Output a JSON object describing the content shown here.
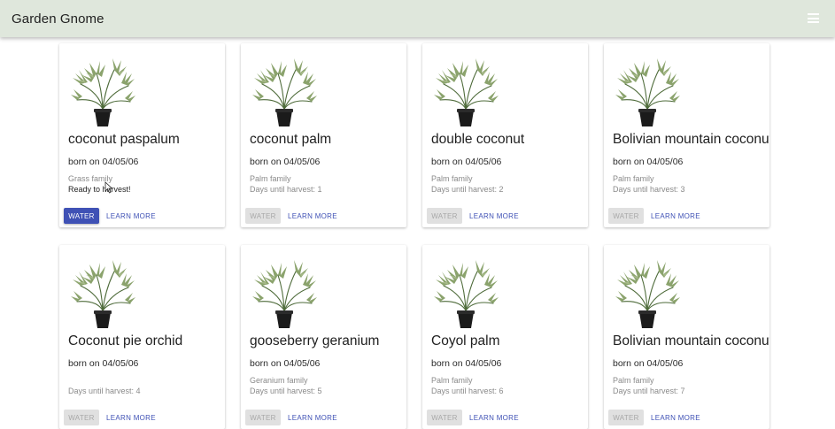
{
  "appbar": {
    "title": "Garden Gnome",
    "menu_icon": "hamburger-menu-icon"
  },
  "card_actions": {
    "water_label": "WATER",
    "learn_label": "LEARN MORE"
  },
  "plant_icon": "potted-palm-icon",
  "colors": {
    "appbar_bg": "#dfe7dc",
    "primary": "#3f51b5",
    "disabled_bg": "#e0e0e0",
    "disabled_text": "#a8a8a8"
  },
  "cards": [
    {
      "name": "coconut paspalum",
      "born": "born on 04/05/06",
      "family": "Grass family",
      "harvest": "Ready to harvest!",
      "water_enabled": true
    },
    {
      "name": "coconut palm",
      "born": "born on 04/05/06",
      "family": "Palm family",
      "harvest": "Days until harvest: 1",
      "water_enabled": false
    },
    {
      "name": "double coconut",
      "born": "born on 04/05/06",
      "family": "Palm family",
      "harvest": "Days until harvest: 2",
      "water_enabled": false
    },
    {
      "name": "Bolivian mountain coconut",
      "born": "born on 04/05/06",
      "family": "Palm family",
      "harvest": "Days until harvest: 3",
      "water_enabled": false
    },
    {
      "name": "Coconut pie orchid",
      "born": "born on 04/05/06",
      "family": "",
      "harvest": "Days until harvest: 4",
      "water_enabled": false
    },
    {
      "name": "gooseberry geranium",
      "born": "born on 04/05/06",
      "family": "Geranium family",
      "harvest": "Days until harvest: 5",
      "water_enabled": false
    },
    {
      "name": "Coyol palm",
      "born": "born on 04/05/06",
      "family": "Palm family",
      "harvest": "Days until harvest: 6",
      "water_enabled": false
    },
    {
      "name": "Bolivian mountain coconut",
      "born": "born on 04/05/06",
      "family": "Palm family",
      "harvest": "Days until harvest: 7",
      "water_enabled": false
    }
  ]
}
